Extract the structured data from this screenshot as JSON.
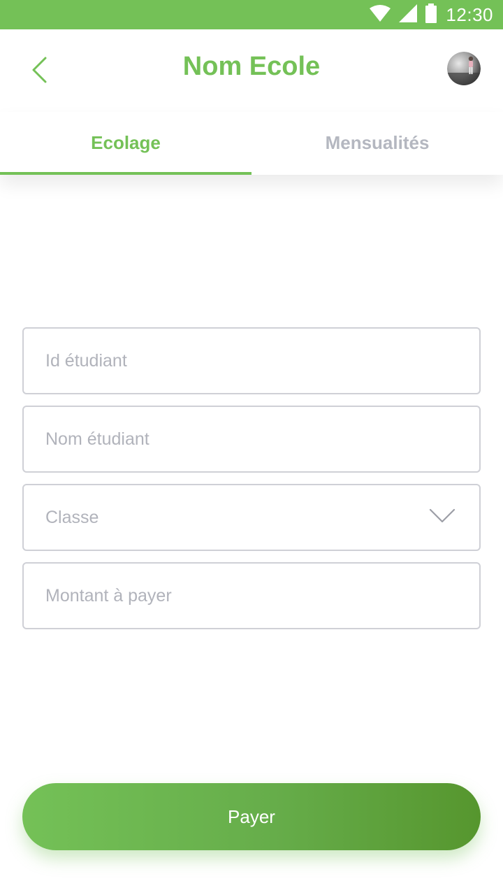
{
  "status_bar": {
    "time": "12:30",
    "icons": [
      "wifi-icon",
      "signal-icon",
      "battery-icon"
    ]
  },
  "header": {
    "title": "Nom Ecole",
    "back_icon": "chevron-left-icon",
    "avatar": "user-avatar"
  },
  "tabs": [
    {
      "label": "Ecolage",
      "active": true
    },
    {
      "label": "Mensualités",
      "active": false
    }
  ],
  "form": {
    "student_id": {
      "placeholder": "Id étudiant",
      "value": ""
    },
    "student_name": {
      "placeholder": "Nom étudiant",
      "value": ""
    },
    "class_select": {
      "label": "Classe",
      "icon": "chevron-down-icon"
    },
    "amount": {
      "placeholder": "Montant à payer",
      "value": ""
    }
  },
  "actions": {
    "pay_label": "Payer"
  },
  "colors": {
    "accent": "#74c157",
    "accent_dark": "#56962e",
    "muted_text": "#b4b7c0",
    "border": "#cfd0d6"
  }
}
